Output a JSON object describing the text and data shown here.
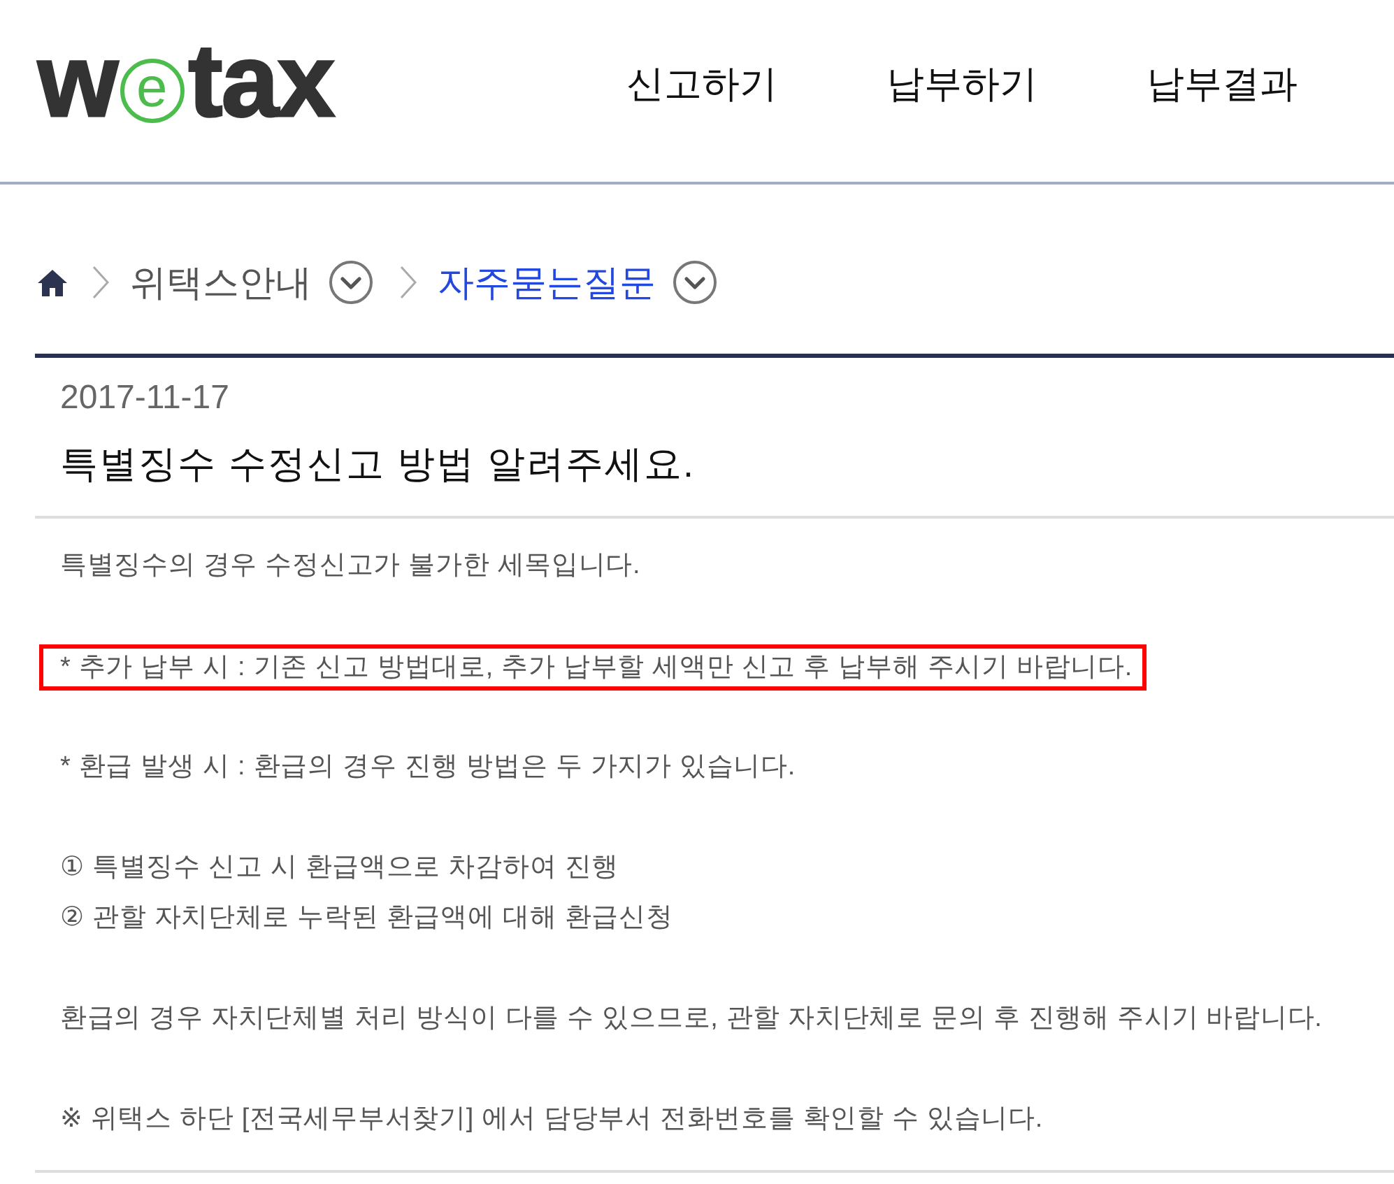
{
  "header": {
    "logo": [
      {
        "text": "w",
        "circled": false
      },
      {
        "text": "e",
        "circled": true
      },
      {
        "text": "tax",
        "circled": false
      }
    ],
    "nav": [
      "신고하기",
      "납부하기",
      "납부결과"
    ]
  },
  "breadcrumb": [
    {
      "label": "위택스안내",
      "selected": false
    },
    {
      "label": "자주묻는질문",
      "selected": true
    }
  ],
  "article": {
    "date": "2017-11-17",
    "title": "특별징수 수정신고 방법 알려주세요.",
    "paragraphs": [
      {
        "lines": [
          "특별징수의 경우 수정신고가 불가한 세목입니다."
        ],
        "highlighted": false
      },
      {
        "lines": [
          "* 추가 납부 시 : 기존 신고 방법대로, 추가 납부할 세액만 신고 후 납부해 주시기 바랍니다."
        ],
        "highlighted": true
      },
      {
        "lines": [
          "* 환급 발생 시 : 환급의 경우 진행 방법은 두 가지가 있습니다."
        ],
        "highlighted": false
      },
      {
        "lines": [
          "① 특별징수 신고 시 환급액으로 차감하여 진행",
          "② 관할 자치단체로 누락된 환급액에 대해 환급신청"
        ],
        "highlighted": false
      },
      {
        "lines": [
          "환급의 경우 자치단체별 처리 방식이 다를 수 있으므로, 관할 자치단체로 문의 후 진행해 주시기 바랍니다."
        ],
        "highlighted": false
      },
      {
        "lines": [
          "※ 위택스 하단 [전국세무부서찾기] 에서 담당부서 전화번호를 확인할 수 있습니다."
        ],
        "highlighted": false
      }
    ]
  }
}
